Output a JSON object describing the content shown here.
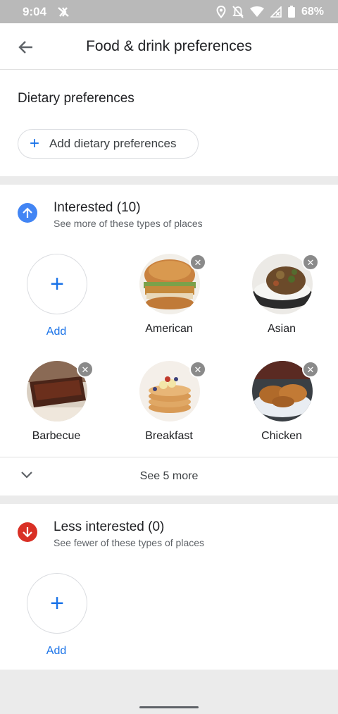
{
  "status": {
    "time": "9:04",
    "battery": "68%"
  },
  "appbar": {
    "title": "Food & drink preferences"
  },
  "dietary": {
    "title": "Dietary preferences",
    "button_label": "Add dietary preferences"
  },
  "interested": {
    "title": "Interested (10)",
    "subtitle": "See more of these types of places",
    "add_label": "Add",
    "items": [
      {
        "label": "American"
      },
      {
        "label": "Asian"
      },
      {
        "label": "Barbecue"
      },
      {
        "label": "Breakfast"
      },
      {
        "label": "Chicken"
      }
    ],
    "more_label": "See 5 more"
  },
  "less_interested": {
    "title": "Less interested (0)",
    "subtitle": "See fewer of these types of places",
    "add_label": "Add"
  },
  "colors": {
    "accent": "#1a73e8",
    "interested_icon": "#4285f4",
    "less_icon": "#d93025"
  }
}
